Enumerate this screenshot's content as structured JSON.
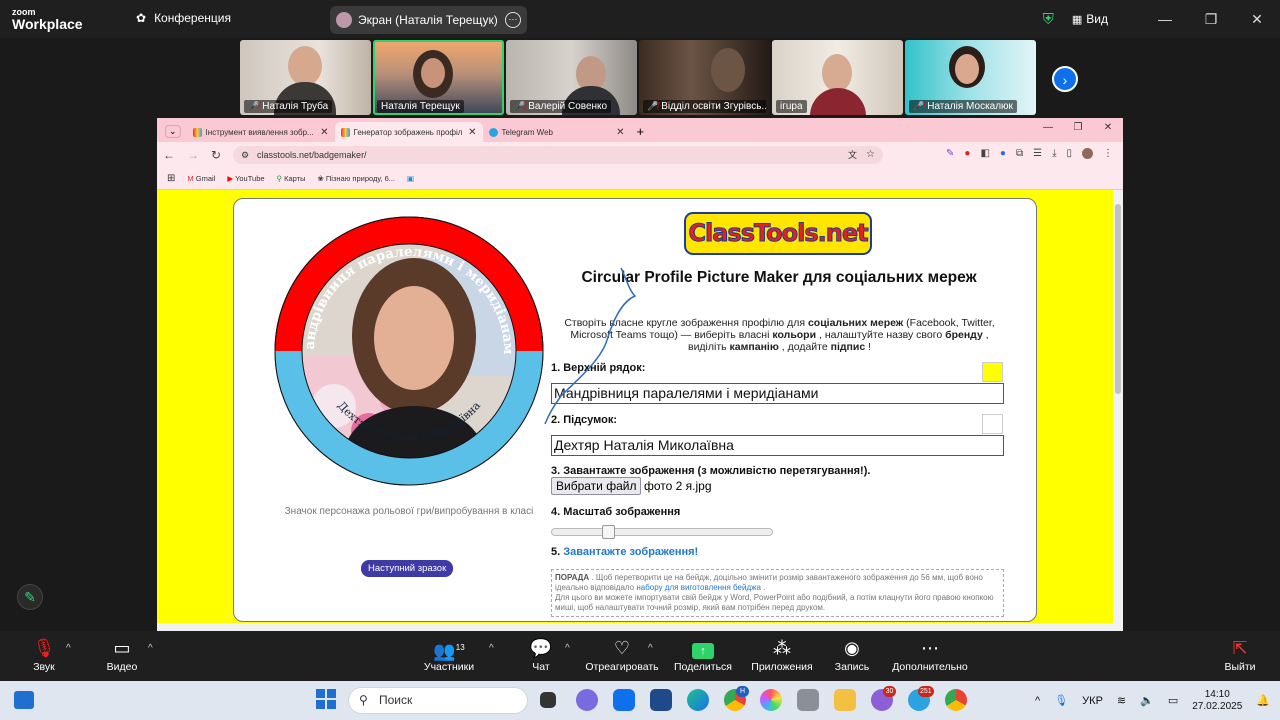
{
  "zoom": {
    "logo_line1": "zoom",
    "logo_line2": "Workplace",
    "conference_label": "Конференция",
    "screen_share_label": "Экран (Наталія Терещук)",
    "view_label": "Вид",
    "participants": [
      {
        "name": "Наталія Труба",
        "muted": true
      },
      {
        "name": "Наталія Терещук",
        "muted": false,
        "active": true
      },
      {
        "name": "Валерій Совенко",
        "muted": true
      },
      {
        "name": "Відділ освіти Згурівсь...",
        "muted": true
      },
      {
        "name": "ігupa",
        "muted": false
      },
      {
        "name": "Наталія Москалюк",
        "muted": true
      }
    ],
    "toolbar": {
      "sound": "Звук",
      "video": "Видео",
      "participants": "Участники",
      "participants_count": "13",
      "chat": "Чат",
      "react": "Отреагировать",
      "share": "Поделиться",
      "apps": "Приложения",
      "record": "Запись",
      "more": "Дополнительно",
      "leave": "Выйти"
    }
  },
  "browser": {
    "tabs": [
      {
        "title": "Інструмент виявлення зобр...",
        "active": false
      },
      {
        "title": "Генератор зображень профілю",
        "active": true
      },
      {
        "title": "Telegram Web",
        "active": false
      }
    ],
    "url": "classtools.net/badgemaker/",
    "bookmarks": [
      "Gmail",
      "YouTube",
      "Карты",
      "Пізнаю природу, 6..."
    ]
  },
  "page": {
    "logo_text": "ClassTools.net",
    "title": "Circular Profile Picture Maker для соціальних мереж",
    "intro_parts": {
      "p1": "Створіть власне кругле зображення профілю для ",
      "b1": "соціальних мереж",
      "p2": " (Facebook, Twitter, Microsoft Teams тощо) — виберіть власні ",
      "b2": "кольори",
      "p3": " , налаштуйте назву свого ",
      "b3": "бренду",
      "p4": " , виділіть ",
      "b4": "кампанію",
      "p5": " , додайте ",
      "b5": "підпис",
      "p6": " !"
    },
    "badge": {
      "top_text": "Мандрівниця паралелями і меридіанами",
      "bottom_text": "Дехтяр Наталія Миколаївна",
      "top_color": "#ff0000",
      "bottom_color": "#5bc0e8"
    },
    "badge_caption": "Значок персонажа рольової гри/випробування в класі",
    "next_sample_button": "Наступний зразок",
    "label_top_row": "1. Верхній рядок:",
    "top_row_value": "Мандрівниця паралелями і меридіанами",
    "top_swatch_color": "#ffff00",
    "label_summary": "2. Підсумок:",
    "summary_value": "Дехтяр Наталія Миколаївна",
    "bottom_swatch_color": "#ffffff",
    "label_upload": "3. Завантажте зображення (з можливістю перетягування!).",
    "choose_file_button": "Вибрати файл",
    "file_name": "фото 2 я.jpg",
    "label_scale": "4. Масштаб зображення",
    "scale_value": 0.24,
    "label_download_prefix": "5.",
    "download_link": "Завантажте зображення!",
    "tip": {
      "label": "ПОРАДА",
      "text1": " . Щоб перетворити це на бейдж, доцільно змінити розмір завантаженого зображення до 56 мм, щоб воно ідеально відповідало ",
      "link": "набору для виготовлення бейджа",
      "text2": " .",
      "text3": "Для цього ви можете імпортувати свій бейдж у Word, PowerPoint або подібний, а потім клацнути його правою кнопкою миші, щоб налаштувати точний розмір, який вам потрібен перед друком."
    }
  },
  "taskbar": {
    "search_placeholder": "Поиск",
    "language": "УКР",
    "time": "14:10",
    "date": "27.02.2025",
    "badges": {
      "viber": "30",
      "telegram": "251",
      "chrome": "H"
    }
  }
}
